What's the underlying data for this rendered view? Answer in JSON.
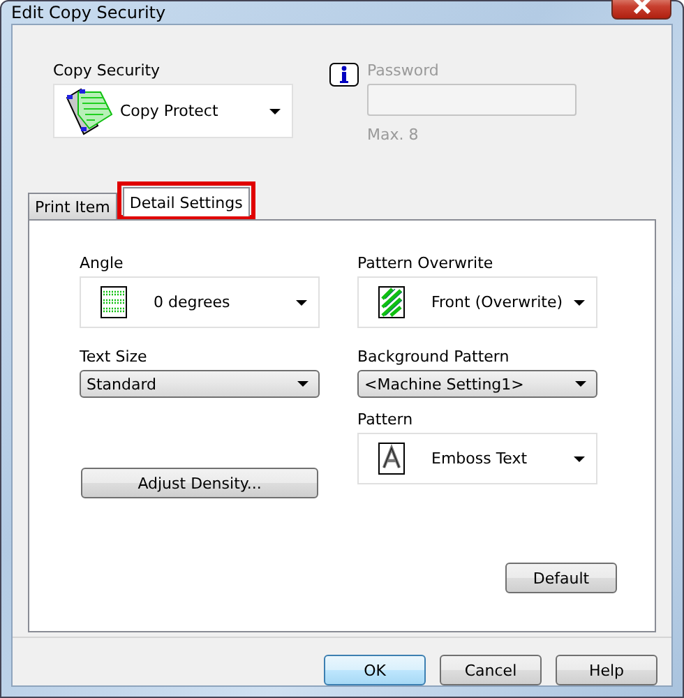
{
  "window": {
    "title": "Edit Copy Security"
  },
  "copy_security": {
    "label": "Copy Security",
    "value": "Copy Protect"
  },
  "password": {
    "label": "Password",
    "disabled": true,
    "hint": "Max. 8"
  },
  "tabs": [
    {
      "label": "Print Item",
      "selected": false,
      "highlighted": false
    },
    {
      "label": "Detail Settings",
      "selected": true,
      "highlighted": true
    }
  ],
  "detail_settings": {
    "angle": {
      "label": "Angle",
      "value": "0 degrees"
    },
    "text_size": {
      "label": "Text Size",
      "value": "Standard"
    },
    "adjust_density": "Adjust Density...",
    "pattern_overwrite": {
      "label": "Pattern Overwrite",
      "value": "Front (Overwrite)"
    },
    "background_pattern": {
      "label": "Background Pattern",
      "value": "<Machine Setting1>"
    },
    "pattern": {
      "label": "Pattern",
      "value": "Emboss Text"
    },
    "default_button": "Default"
  },
  "buttons": [
    {
      "label": "OK",
      "default": true
    },
    {
      "label": "Cancel",
      "default": false
    },
    {
      "label": "Help",
      "default": false
    }
  ]
}
